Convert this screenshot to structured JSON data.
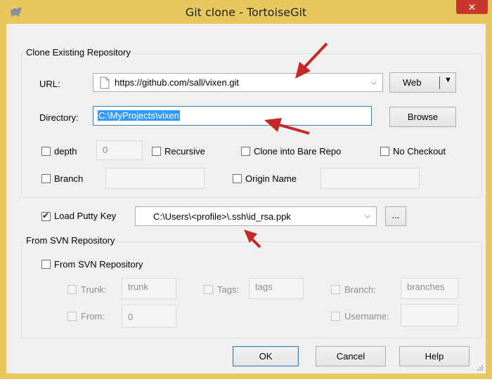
{
  "window": {
    "title": "Git clone - TortoiseGit",
    "close_glyph": "✕",
    "app_icon": "tortoise-icon"
  },
  "clone_group": {
    "legend": "Clone Existing Repository",
    "url_label": "URL:",
    "url_value": "https://github.com/sall/vixen.git",
    "web_button": "Web",
    "directory_label": "Directory:",
    "directory_value": "C:\\MyProjects\\vixen",
    "browse_button": "Browse",
    "depth_label": "depth",
    "depth_value": "0",
    "recursive_label": "Recursive",
    "bare_label": "Clone into Bare Repo",
    "no_checkout_label": "No Checkout",
    "branch_label": "Branch",
    "origin_label": "Origin Name"
  },
  "putty": {
    "label": "Load Putty Key",
    "checked": true,
    "value": "C:\\Users\\<profile>\\.ssh\\id_rsa.ppk",
    "browse_button": "..."
  },
  "svn_group": {
    "legend": "From SVN Repository",
    "checkbox_label": "From SVN Repository",
    "trunk_label": "Trunk:",
    "trunk_value": "trunk",
    "tags_label": "Tags:",
    "tags_value": "tags",
    "branch_label": "Branch:",
    "branch_value": "branches",
    "from_label": "From:",
    "from_value": "0",
    "username_label": "Username:"
  },
  "buttons": {
    "ok": "OK",
    "cancel": "Cancel",
    "help": "Help"
  },
  "colors": {
    "frame": "#e7c85f",
    "close": "#c7372b",
    "annotation_arrow": "#c62828",
    "selection": "#3399ff"
  }
}
